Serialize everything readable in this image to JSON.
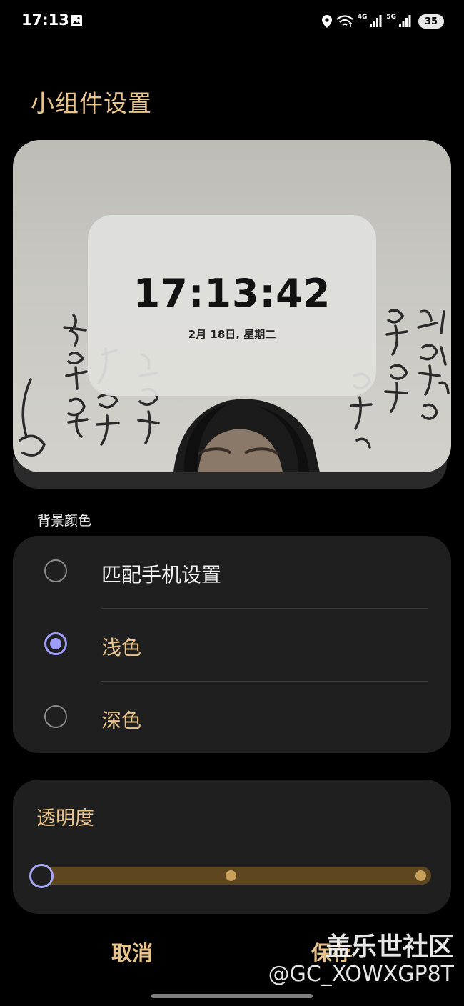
{
  "status_bar": {
    "time": "17:13",
    "net_4g": "4G",
    "net_5g": "5G",
    "battery": "35",
    "icons": [
      "gallery-icon",
      "location-icon",
      "wifi-icon",
      "signal-icon",
      "signal-icon",
      "battery-icon"
    ]
  },
  "title": "小组件设置",
  "preview": {
    "time": "17:13:42",
    "date": "2月 18日, 星期二"
  },
  "background_color": {
    "label": "背景颜色",
    "options": [
      {
        "label": "匹配手机设置",
        "selected": false
      },
      {
        "label": "浅色",
        "selected": true
      },
      {
        "label": "深色",
        "selected": false
      }
    ]
  },
  "transparency": {
    "label": "透明度",
    "value_fraction": 0,
    "steps": 3
  },
  "buttons": {
    "cancel": "取消",
    "save": "保存"
  },
  "watermark": {
    "title": "盖乐世社区",
    "user": "@GC_XOWXGP8T"
  },
  "colors": {
    "accent_gold": "#e9c48a",
    "radio_selected": "#9d9dfb",
    "card_bg": "#1f1f1f",
    "slider_track": "#5e4620"
  }
}
